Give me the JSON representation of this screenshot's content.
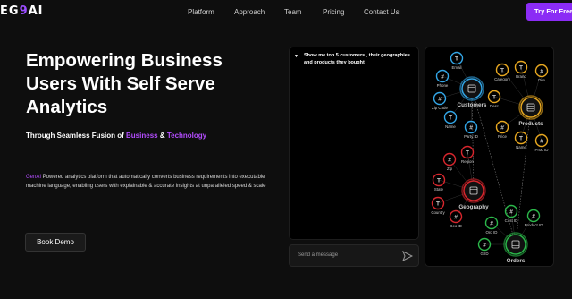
{
  "brand": {
    "logo_text": "EG",
    "logo_accent": "9",
    "logo_tail": "AI"
  },
  "nav": {
    "links": [
      "Platform",
      "Approach",
      "Team",
      "Pricing",
      "Contact Us"
    ],
    "cta": "Try For Free"
  },
  "hero": {
    "title": "Empowering Business Users With Self Serve Analytics",
    "subtitle_pre": "Through Seamless Fusion of ",
    "subtitle_word1": "Business",
    "subtitle_amp": " & ",
    "subtitle_word2": "Technology",
    "desc_brand": "GenAI",
    "desc_text": " Powered analytics platform that automatically converts business requirements into executable machine language, enabling users with explainable & accurate insights at unparalleled speed & scale",
    "demo_button": "Book Demo"
  },
  "chat": {
    "question": "Show me top 5 customers , their geographies and products they bought",
    "input_placeholder": "Send a message"
  },
  "graph": {
    "entities": [
      {
        "id": "customers",
        "label": "Customers",
        "color": "#33a7e8"
      },
      {
        "id": "products",
        "label": "Products",
        "color": "#e8a820"
      },
      {
        "id": "geography",
        "label": "Geography",
        "color": "#d8262d"
      },
      {
        "id": "orders",
        "label": "Orders",
        "color": "#2bb84a"
      }
    ],
    "attributes": [
      {
        "label": "Email",
        "type": "T",
        "color": "#33a7e8"
      },
      {
        "label": "Phone",
        "type": "#",
        "color": "#33a7e8"
      },
      {
        "label": "Zip Code",
        "type": "#",
        "color": "#33a7e8"
      },
      {
        "label": "Name",
        "type": "T",
        "color": "#33a7e8"
      },
      {
        "label": "Party ID",
        "type": "#",
        "color": "#33a7e8"
      },
      {
        "label": "Category",
        "type": "T",
        "color": "#e8a820"
      },
      {
        "label": "Brand",
        "type": "T",
        "color": "#e8a820"
      },
      {
        "label": "Dim",
        "type": "#",
        "color": "#e8a820"
      },
      {
        "label": "Desc",
        "type": "T",
        "color": "#e8a820"
      },
      {
        "label": "Price",
        "type": "#",
        "color": "#e8a820"
      },
      {
        "label": "Name",
        "type": "T",
        "color": "#e8a820"
      },
      {
        "label": "Prod ID",
        "type": "#",
        "color": "#e8a820"
      },
      {
        "label": "Zip",
        "type": "#",
        "color": "#d8262d"
      },
      {
        "label": "Region",
        "type": "T",
        "color": "#d8262d"
      },
      {
        "label": "State",
        "type": "T",
        "color": "#d8262d"
      },
      {
        "label": "Country",
        "type": "T",
        "color": "#d8262d"
      },
      {
        "label": "Geo ID",
        "type": "#",
        "color": "#d8262d"
      },
      {
        "label": "Cust ID",
        "type": "#",
        "color": "#2bb84a"
      },
      {
        "label": "Product ID",
        "type": "#",
        "color": "#2bb84a"
      },
      {
        "label": "Ord ID",
        "type": "#",
        "color": "#2bb84a"
      },
      {
        "label": "G ID",
        "type": "#",
        "color": "#2bb84a"
      }
    ]
  },
  "colors": {
    "accent": "#8b2cf5",
    "purple_text": "#b44dff",
    "background": "#0e0e0e"
  }
}
